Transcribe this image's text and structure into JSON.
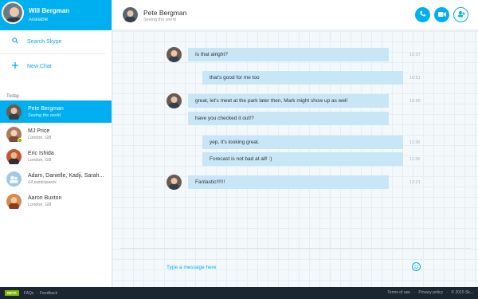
{
  "profile": {
    "name": "Will Bergman",
    "status": "Available"
  },
  "menu": {
    "search": "Search Skype",
    "new_chat": "New Chat"
  },
  "section_today": "Today",
  "contacts": [
    {
      "name": "Pete Bergman",
      "sub": "Seeing the world",
      "color": "#6b5a4e"
    },
    {
      "name": "MJ Price",
      "sub": "London, GB",
      "color": "#b07a5e"
    },
    {
      "name": "Eric Ishida",
      "sub": "London, GB",
      "color": "#c2572e"
    },
    {
      "name": "Adam, Danielle, Kadji, Sarah...",
      "sub": "14 participants",
      "color": "#9ec9ea"
    },
    {
      "name": "Aaron Buxton",
      "sub": "London, GB",
      "color": "#d78a4a"
    }
  ],
  "chat": {
    "name": "Pete Bergman",
    "status": "Seeing the world",
    "messages": [
      {
        "text": "Is that alright?",
        "time": "10:37"
      },
      {
        "text": "that's good for me too",
        "time": "10:51"
      },
      {
        "text": "great, let's meet at the park later then, Mark might show up as well",
        "time": "10:56"
      },
      {
        "text": "have you checked it out!?",
        "time": ""
      },
      {
        "text": "yep, it's looking great.",
        "time": "11:36"
      },
      {
        "text": "Forecast is not bad at all! :)",
        "time": "11:36"
      },
      {
        "text": "Fantastic!!!!!!",
        "time": "12:21"
      }
    ],
    "placeholder": "Type a message here"
  },
  "footer": {
    "beta": "BETA",
    "faqs": "FAQs",
    "feedback": "Feedback",
    "terms": "Terms of use",
    "privacy": "Privacy policy",
    "copyright": "© 2015 Sk..."
  },
  "colors": {
    "accent": "#00aff0",
    "bubble": "#c7e6f6",
    "presence": "#7fba00"
  },
  "icons": [
    "search-icon",
    "plus-icon",
    "phone-icon",
    "video-icon",
    "add-contact-icon",
    "emoji-icon"
  ]
}
